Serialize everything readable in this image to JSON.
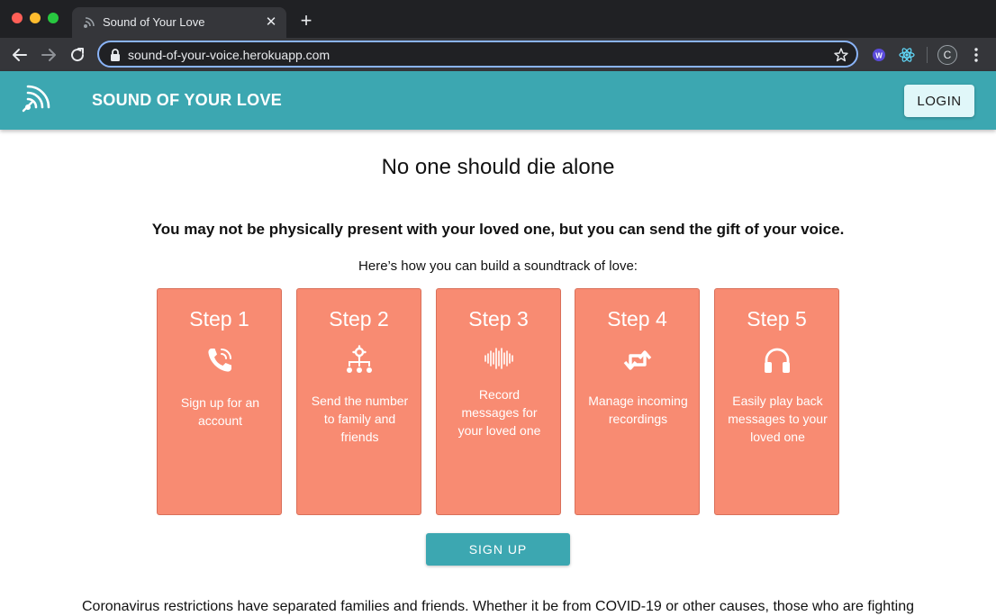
{
  "browser": {
    "tab_title": "Sound of Your Love",
    "url": "sound-of-your-voice.herokuapp.com",
    "profile_initial": "C",
    "colors": {
      "frame": "#202124",
      "toolbar": "#35363a",
      "focus_ring": "#8ab4f8"
    }
  },
  "header": {
    "brand": "SOUND OF YOUR LOVE",
    "login_label": "LOGIN",
    "colors": {
      "bar": "#3ca7b1",
      "login_bg": "#e0f7f9"
    }
  },
  "main": {
    "headline": "No one should die alone",
    "subhead": "You may not be physically present with your loved one, but you can send the gift of your voice.",
    "intro": "Here’s how you can build a soundtrack of love:",
    "steps": [
      {
        "title": "Step 1",
        "icon": "phone-icon",
        "description": "Sign up for an account"
      },
      {
        "title": "Step 2",
        "icon": "sitemap-icon",
        "description": "Send the number to family and friends"
      },
      {
        "title": "Step 3",
        "icon": "waveform-icon",
        "description": "Record messages for your loved one"
      },
      {
        "title": "Step 4",
        "icon": "retweet-icon",
        "description": "Manage incoming recordings"
      },
      {
        "title": "Step 5",
        "icon": "headphones-icon",
        "description": "Easily play back messages to your loved one"
      }
    ],
    "signup_label": "SIGN UP",
    "footer": "Coronavirus restrictions have separated families and friends. Whether it be from COVID-19 or other causes, those who are fighting",
    "colors": {
      "card": "#f88b72",
      "button": "#3ca7b1"
    }
  }
}
